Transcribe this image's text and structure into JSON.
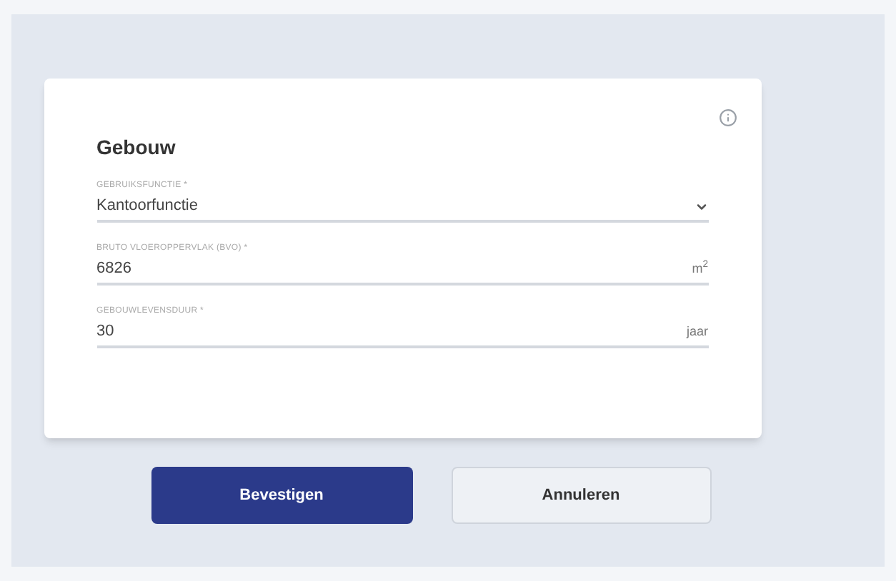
{
  "card": {
    "title": "Gebouw",
    "fields": [
      {
        "kind": "select",
        "label": "GEBRUIKSFUNCTIE *",
        "value": "Kantoorfunctie"
      },
      {
        "kind": "unit",
        "label": "BRUTO VLOEROPPERVLAK (BVO) *",
        "value": "6826",
        "unit": "m$^{2}$"
      },
      {
        "kind": "unit",
        "label": "GEBOUWLEVENSDUUR *",
        "value": "30",
        "unit": "jaar"
      }
    ]
  },
  "buttons": [
    {
      "kind": "primary",
      "label": "Bevestigen"
    },
    {
      "kind": "secondary",
      "label": "Annuleren"
    }
  ]
}
